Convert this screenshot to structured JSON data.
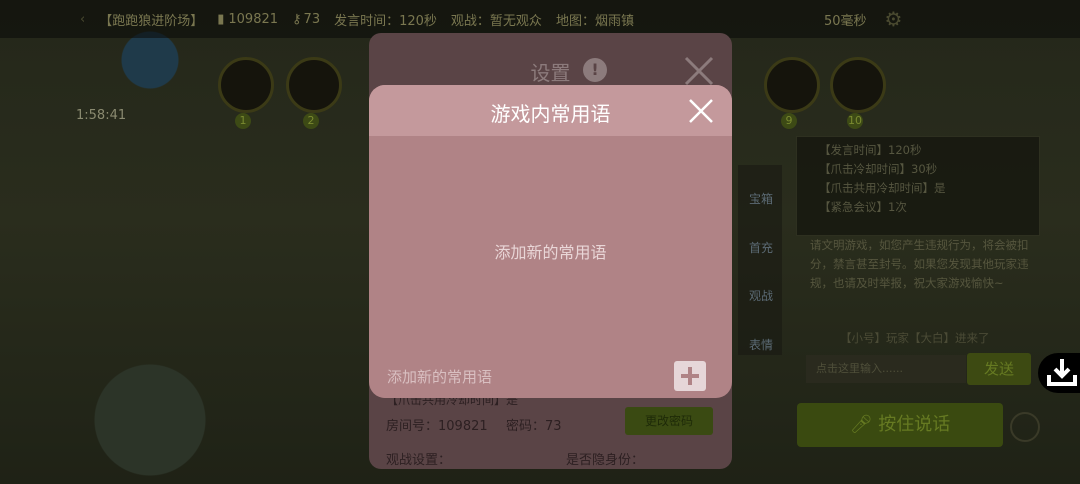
{
  "top_bar": {
    "room_name": "【跑跑狼进阶场】",
    "room_number": "109821",
    "password": "73",
    "speak_time": "发言时间：120秒",
    "spectate": "观战：暂无观众",
    "map": "地图：烟雨镇",
    "latency": "50毫秒"
  },
  "game": {
    "timer": "1:58:41",
    "seats": [
      "1",
      "2",
      "9",
      "10"
    ]
  },
  "side_menu": {
    "items": [
      "宝箱",
      "首充",
      "观战",
      "表情"
    ]
  },
  "info_panel": {
    "lines": [
      "【发言时间】120秒",
      "【爪击冷却时间】30秒",
      "【爪击共用冷却时间】是",
      "【紧急会议】1次"
    ]
  },
  "rules_panel": {
    "text": "请文明游戏，如您产生违规行为，将会被扣分，禁言甚至封号。如果您发现其他玩家违规，也请及时举报，祝大家游戏愉快~",
    "join_notice": "【小号】玩家【大白】进来了"
  },
  "chat": {
    "input_placeholder": "点击这里输入......",
    "send_label": "发送",
    "voice_label": "按住说话"
  },
  "settings_dialog": {
    "title": "设置",
    "row_label": "【爪击共用冷却时间】是",
    "room_number": "房间号：109821",
    "password": "密码：73",
    "change_password": "更改密码",
    "spectate_setting": "观战设置：",
    "show_identity": "是否隐身份："
  },
  "phrases_modal": {
    "title": "游戏内常用语",
    "empty_text": "添加新的常用语",
    "input_placeholder": "添加新的常用语"
  },
  "colors": {
    "modal_bg": "#b08386",
    "modal_header": "#c4999c",
    "settings_bg": "#5a4446"
  },
  "icons": [
    "settings-gear-icon",
    "close-icon",
    "plus-icon",
    "download-icon",
    "help-icon",
    "key-icon",
    "door-icon",
    "microphone-icon",
    "speaker-icon"
  ]
}
